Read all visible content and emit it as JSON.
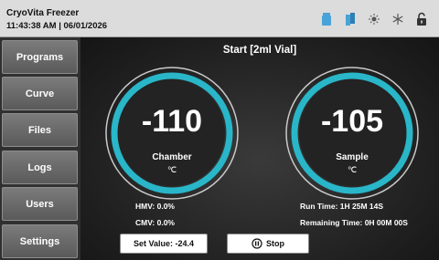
{
  "header": {
    "app_title": "CryoVita Freezer",
    "datetime": "11:43:38 AM | 06/01/2026",
    "status_icons": [
      "vial-icon",
      "vial-pair-icon",
      "sun-icon",
      "snowflake-icon",
      "unlocked-padlock-icon"
    ]
  },
  "sidebar": {
    "items": [
      {
        "label": "Programs"
      },
      {
        "label": "Curve"
      },
      {
        "label": "Files"
      },
      {
        "label": "Logs"
      },
      {
        "label": "Users"
      },
      {
        "label": "Settings"
      }
    ]
  },
  "main": {
    "title": "Start [2ml Vial]",
    "chamber": {
      "value": "-110",
      "label": "Chamber",
      "unit": "℃"
    },
    "sample": {
      "value": "-105",
      "label": "Sample",
      "unit": "℃"
    },
    "hmv": "HMV: 0.0%",
    "cmv": "CMV: 0.0%",
    "run_time": "Run Time: 1H 25M 14S",
    "remaining_time": "Remaining Time: 0H 00M 00S",
    "set_value_button": "Set Value: -24.4",
    "stop_button": "Stop"
  },
  "colors": {
    "accent": "#29b6c9",
    "header_bg": "#dcdcdc",
    "nav_bg": "#6a6a6a"
  }
}
